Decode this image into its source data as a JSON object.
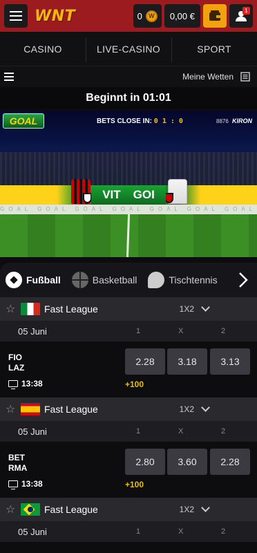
{
  "header": {
    "logo": "WNT",
    "coins": "0",
    "coin_symbol": "W",
    "balance": "0,00 €",
    "notifications": "1"
  },
  "nav": {
    "tabs": [
      "CASINO",
      "LIVE-CASINO",
      "SPORT"
    ]
  },
  "subbar": {
    "my_bets": "Meine Wetten"
  },
  "countdown": "Beginnt in 01:01",
  "video": {
    "goal_logo": "GOAL",
    "bets_close_label": "BETS CLOSE IN:",
    "bets_close_digits": "0 1 : 0",
    "match_id": "8876",
    "brand": "KIRON",
    "home": "VIT",
    "away": "GOI",
    "ad_text": "GOAL GOAL GOAL GOAL GOAL GOAL GOAL GOAL GOAL GOAL GOAL GOAL"
  },
  "sports": [
    "Fußball",
    "Basketball",
    "Tischtennis"
  ],
  "market_headers": [
    "1",
    "X",
    "2"
  ],
  "leagues": [
    {
      "name": "Fast League",
      "flag": "it",
      "market": "1X2",
      "date": "05 Juni",
      "match": {
        "home": "FIO",
        "away": "LAZ",
        "time": "13:38",
        "odds": [
          "2.28",
          "3.18",
          "3.13"
        ],
        "more": "+100"
      }
    },
    {
      "name": "Fast League",
      "flag": "es",
      "market": "1X2",
      "date": "05 Juni",
      "match": {
        "home": "BET",
        "away": "RMA",
        "time": "13:38",
        "odds": [
          "2.80",
          "3.60",
          "2.28"
        ],
        "more": "+100"
      }
    },
    {
      "name": "Fast League",
      "flag": "br",
      "market": "1X2",
      "date": "05 Juni"
    }
  ],
  "colors": {
    "header_red": "#9b1b1f",
    "accent_gold": "#f2a20d",
    "odd_bg": "#3a3a40",
    "more_yellow": "#e6c200"
  }
}
